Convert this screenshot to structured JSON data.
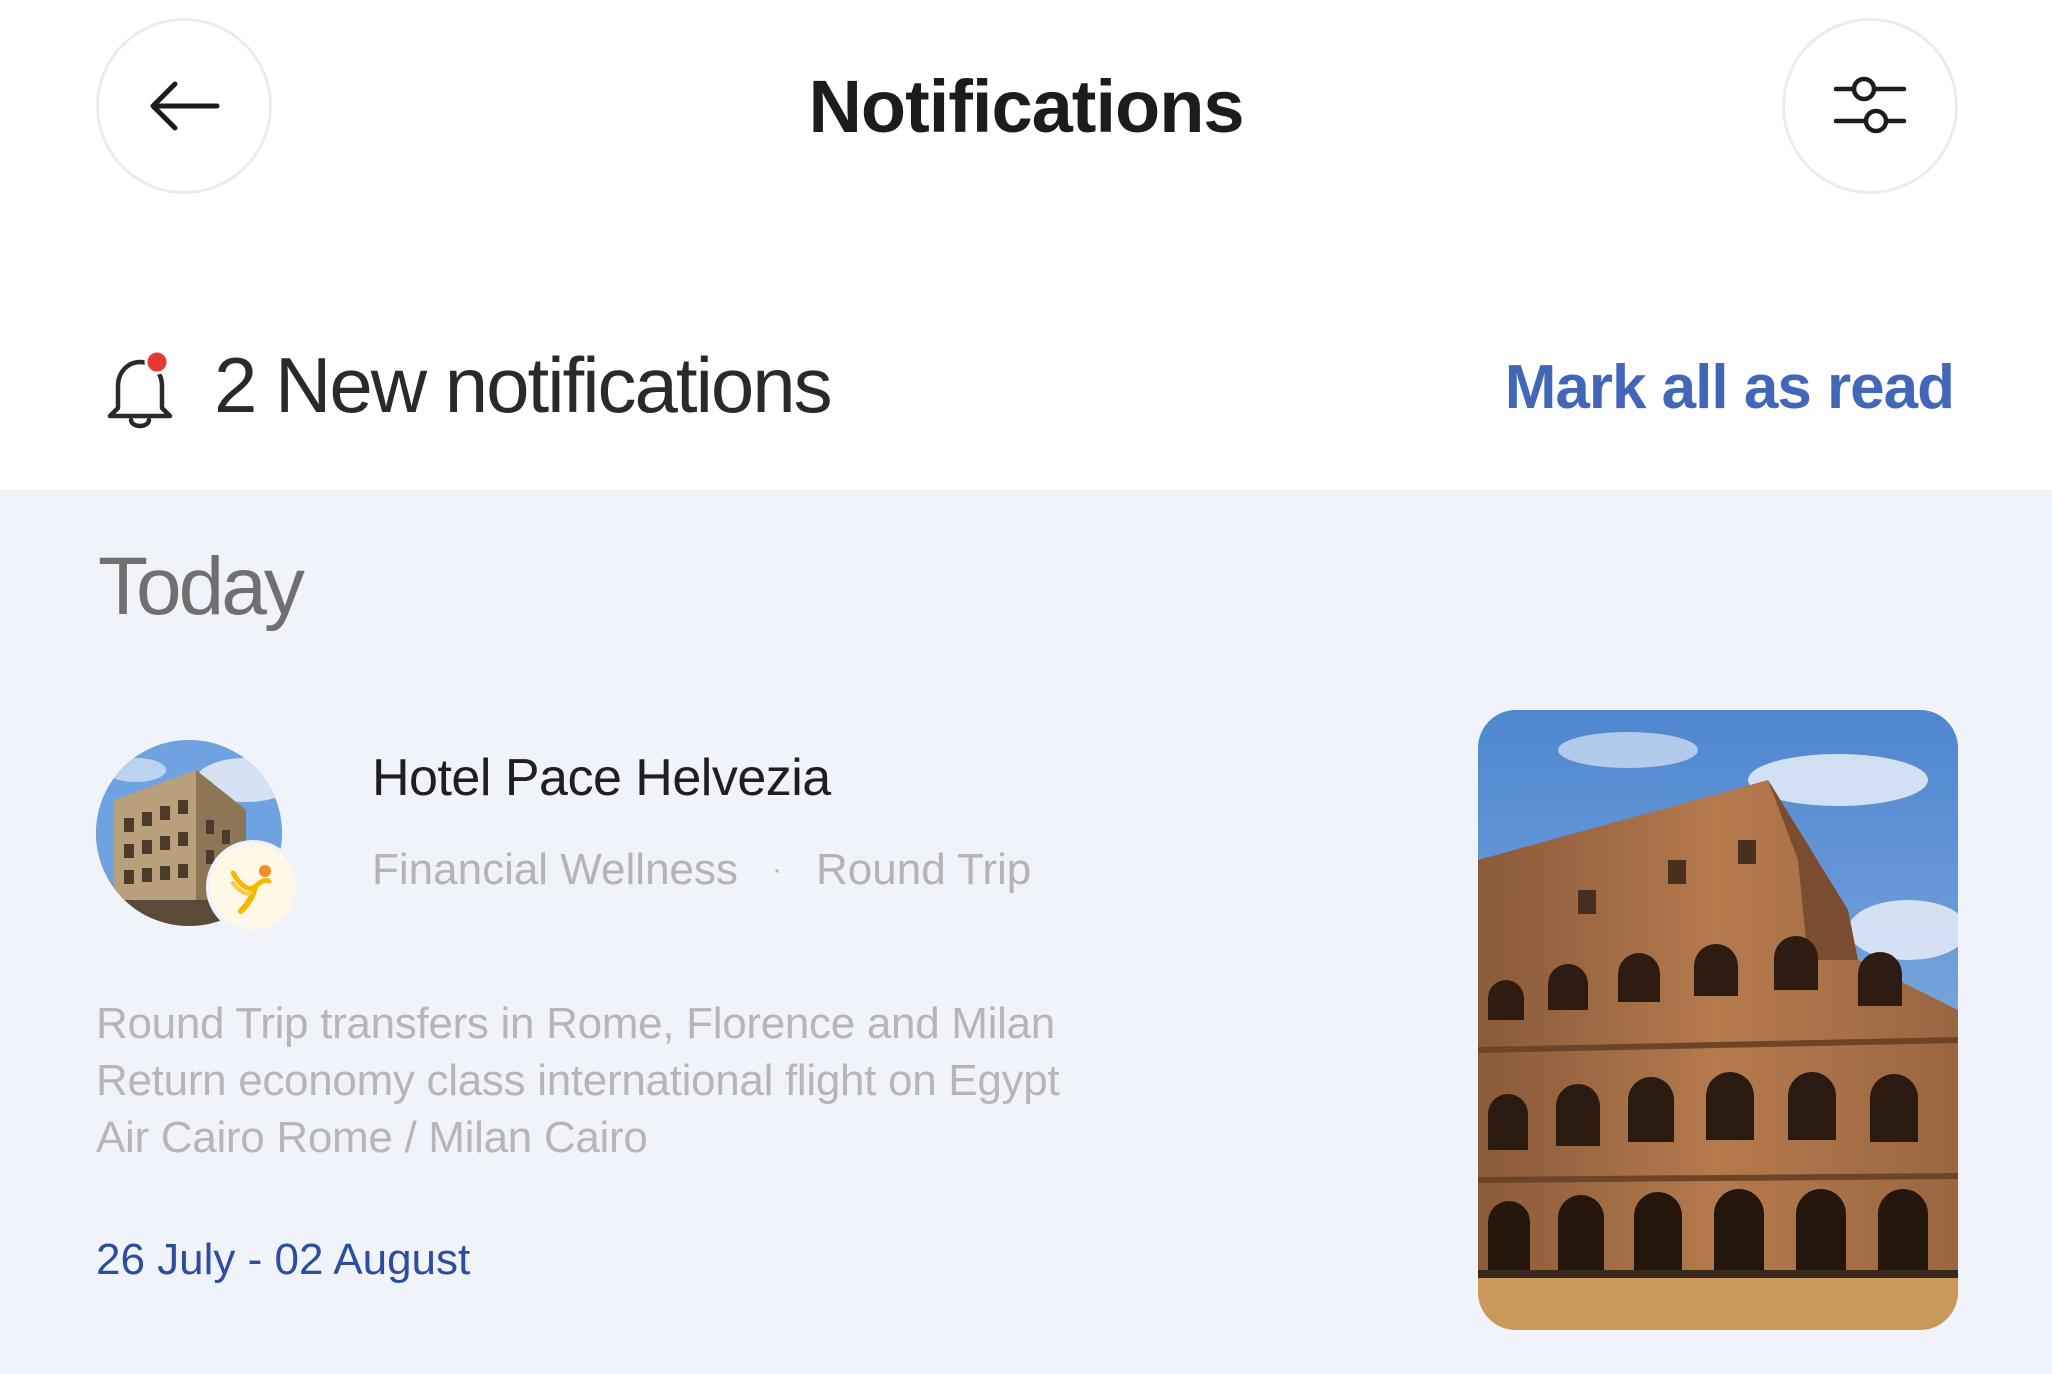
{
  "header": {
    "title": "Notifications",
    "back_icon": "arrow-left-icon",
    "filter_icon": "sliders-icon"
  },
  "summary": {
    "new_count_text": "2 New notifications",
    "mark_all_label": "Mark all as read",
    "bell_icon": "bell-icon",
    "unread_dot_color": "#e53935"
  },
  "sections": [
    {
      "label": "Today",
      "items": [
        {
          "title": "Hotel Pace Helvezia",
          "category": "Financial Wellness",
          "separator": "·",
          "type": "Round Trip",
          "description_lines": [
            "Round Trip transfers in Rome,  Florence and Milan",
            "Return economy class international flight on Egypt",
            "Air Cairo Rome / Milan Cairo"
          ],
          "dates": "26 July - 02 August"
        }
      ]
    }
  ],
  "colors": {
    "accent": "#4367b8",
    "date_text": "#2d4e9e",
    "panel_bg": "#f0f3f9"
  }
}
